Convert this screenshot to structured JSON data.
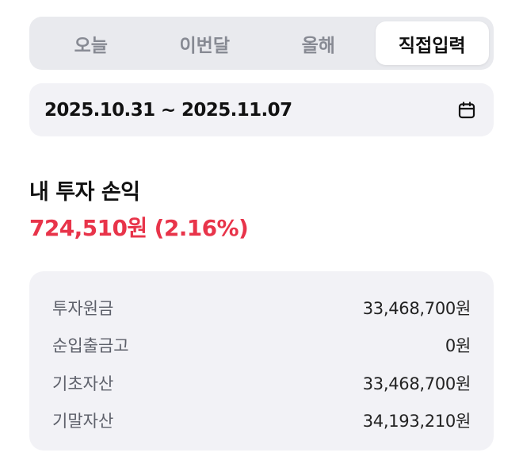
{
  "period_tabs": [
    {
      "label": "오늘",
      "active": false
    },
    {
      "label": "이번달",
      "active": false
    },
    {
      "label": "올해",
      "active": false
    },
    {
      "label": "직접입력",
      "active": true
    }
  ],
  "date_range": {
    "text": "2025.10.31 ~ 2025.11.07",
    "icon": "calendar-icon"
  },
  "profit": {
    "title": "내 투자 손익",
    "value": "724,510원 (2.16%)",
    "color": "#e8344a"
  },
  "details": [
    {
      "label": "투자원금",
      "value": "33,468,700원"
    },
    {
      "label": "순입출금고",
      "value": "0원"
    },
    {
      "label": "기초자산",
      "value": "33,468,700원"
    },
    {
      "label": "기말자산",
      "value": "34,193,210원"
    }
  ]
}
